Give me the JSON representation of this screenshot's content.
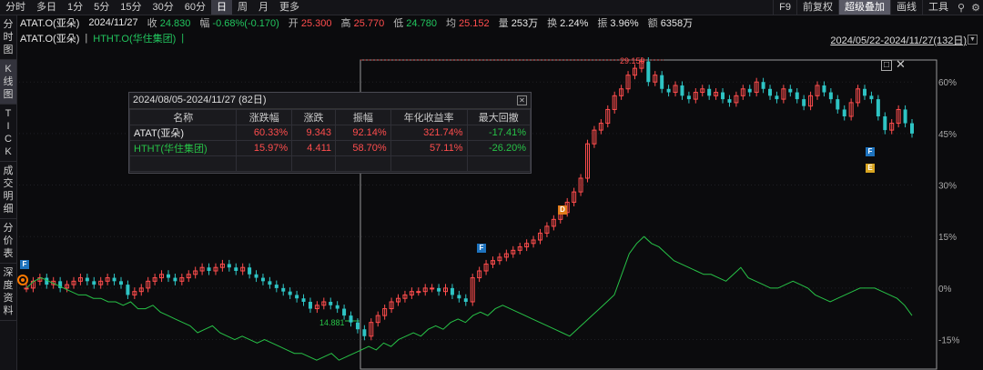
{
  "toolbar": {
    "periods": [
      "分时",
      "多日",
      "1分",
      "5分",
      "15分",
      "30分",
      "60分",
      "日",
      "周",
      "月",
      "更多"
    ],
    "active_period": "日",
    "right_items": [
      "F9",
      "前复权",
      "超级叠加",
      "画线",
      "工具"
    ],
    "active_right": "超级叠加"
  },
  "info": {
    "name": "ATAT.O(亚朵)",
    "date": "2024/11/27",
    "close_label": "收",
    "close": "24.830",
    "change_label": "幅",
    "change": "-0.68%(-0.170)",
    "open_label": "开",
    "open": "25.300",
    "high_label": "高",
    "high": "25.770",
    "low_label": "低",
    "low": "24.780",
    "avg_label": "均",
    "avg": "25.152",
    "vol_label": "量",
    "vol": "253万",
    "turn_label": "换",
    "turn": "2.24%",
    "amp_label": "振",
    "amp": "3.96%",
    "amt_label": "额",
    "amt": "6358万"
  },
  "compare": {
    "main": "ATAT.O(亚朵)",
    "overlay": "HTHT.O(华住集团)",
    "range": "2024/05/22-2024/11/27(132日)"
  },
  "sidebar": {
    "tabs": [
      [
        "分",
        "时",
        "图"
      ],
      [
        "K",
        "线",
        "图"
      ],
      [
        "T",
        "I",
        "C",
        "K"
      ],
      [
        "成",
        "交",
        "明",
        "细"
      ],
      [
        "分",
        "价",
        "表"
      ],
      [
        "深",
        "度",
        "资",
        "料"
      ]
    ],
    "active_index": 1
  },
  "popup": {
    "title": "2024/08/05-2024/11/27 (82日)",
    "headers": [
      "名称",
      "涨跌幅",
      "涨跌",
      "振幅",
      "年化收益率",
      "最大回撤"
    ],
    "rows": [
      [
        "ATAT(亚朵)",
        "60.33%",
        "9.343",
        "92.14%",
        "321.74%",
        "-17.41%"
      ],
      [
        "HTHT(华住集团)",
        "15.97%",
        "4.411",
        "58.70%",
        "57.11%",
        "-26.20%"
      ]
    ]
  },
  "chart_annotations": {
    "high_label": "29.150",
    "low_label": "14.881"
  },
  "markers": [
    {
      "text": "F",
      "color": "#1e73be"
    },
    {
      "text": "F",
      "color": "#1e73be"
    },
    {
      "text": "D",
      "color": "#e07b1a"
    },
    {
      "text": "F",
      "color": "#1e73be"
    },
    {
      "text": "E",
      "color": "#d9a520"
    }
  ],
  "chart_data": {
    "type": "line",
    "y_ticks": [
      "60%",
      "45%",
      "30%",
      "15%",
      "0%",
      "-15%"
    ],
    "y_tick_values": [
      60,
      45,
      30,
      15,
      0,
      -15
    ],
    "ylim": [
      -22,
      68
    ],
    "series": [
      {
        "name": "ATAT.O(亚朵)",
        "kind": "candlestick",
        "color_up": "#ff4d4d",
        "color_down": "#2ec4c4",
        "values": [
          0,
          2,
          3,
          1,
          2,
          0,
          1,
          2,
          3,
          2,
          1,
          2,
          3,
          2,
          1,
          -2,
          -1,
          0,
          2,
          3,
          4,
          3,
          2,
          3,
          4,
          5,
          6,
          5,
          6,
          7,
          6,
          5,
          6,
          4,
          3,
          2,
          1,
          0,
          -1,
          -2,
          -3,
          -4,
          -6,
          -5,
          -4,
          -5,
          -6,
          -8,
          -10,
          -12,
          -14,
          -10,
          -8,
          -6,
          -4,
          -3,
          -2,
          -1,
          -1,
          0,
          0,
          -1,
          0,
          -2,
          -3,
          -4,
          3,
          5,
          7,
          8,
          9,
          10,
          11,
          12,
          13,
          14,
          16,
          18,
          20,
          22,
          25,
          28,
          32,
          42,
          46,
          48,
          52,
          56,
          58,
          62,
          64,
          66,
          60,
          62,
          58,
          57,
          59,
          56,
          55,
          57,
          58,
          56,
          57,
          55,
          54,
          56,
          58,
          57,
          60,
          58,
          56,
          55,
          58,
          57,
          55,
          53,
          56,
          59,
          57,
          55,
          52,
          50,
          54,
          58,
          56,
          55,
          50,
          46,
          48,
          52,
          48,
          45
        ]
      },
      {
        "name": "HTHT.O(华住集团)",
        "kind": "line",
        "color": "#27c247",
        "values": [
          0,
          2,
          3,
          2,
          1,
          0,
          -1,
          -2,
          -2,
          -3,
          -3,
          -4,
          -4,
          -5,
          -4,
          -6,
          -6,
          -5,
          -7,
          -8,
          -9,
          -10,
          -11,
          -13,
          -12,
          -11,
          -13,
          -14,
          -15,
          -14,
          -15,
          -16,
          -15,
          -16,
          -17,
          -18,
          -19,
          -19,
          -20,
          -21,
          -20,
          -19,
          -21,
          -20,
          -19,
          -18,
          -17,
          -18,
          -16,
          -17,
          -15,
          -14,
          -13,
          -14,
          -12,
          -11,
          -12,
          -10,
          -9,
          -10,
          -8,
          -7,
          -8,
          -6,
          -5,
          -6,
          -7,
          -8,
          -9,
          -10,
          -11,
          -12,
          -13,
          -14,
          -12,
          -10,
          -8,
          -6,
          -4,
          -2,
          4,
          10,
          13,
          15,
          13,
          12,
          10,
          8,
          7,
          6,
          5,
          4,
          4,
          3,
          2,
          4,
          6,
          3,
          2,
          1,
          0,
          0,
          1,
          2,
          1,
          0,
          -2,
          -3,
          -4,
          -3,
          -2,
          -1,
          0,
          0,
          0,
          -1,
          -2,
          -3,
          -5,
          -8
        ]
      }
    ]
  }
}
